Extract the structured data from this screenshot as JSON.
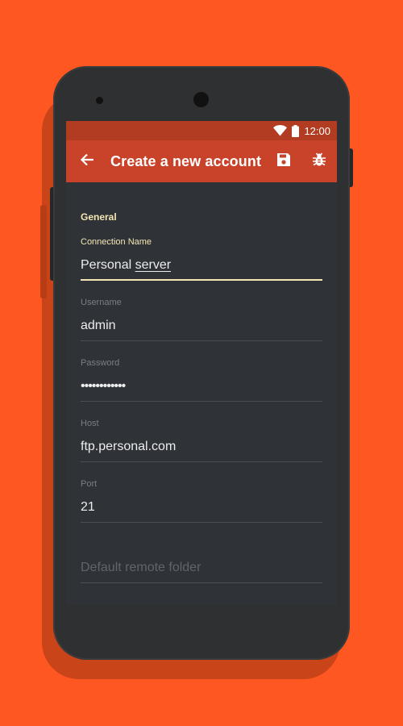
{
  "status_bar": {
    "time": "12:00"
  },
  "app_bar": {
    "title": "Create a new account"
  },
  "form": {
    "section_title": "General",
    "fields": [
      {
        "label": "Connection Name",
        "value_prefix": "Personal ",
        "value_underlined": "server"
      },
      {
        "label": "Username",
        "value": "admin"
      },
      {
        "label": "Password",
        "value": "••••••••••••"
      },
      {
        "label": "Host",
        "value": "ftp.personal.com"
      },
      {
        "label": "Port",
        "value": "21"
      },
      {
        "placeholder": "Default remote folder"
      }
    ]
  },
  "colors": {
    "background": "#fe5722",
    "app_bar": "#c9432a",
    "status_bar": "#b13c21",
    "screen_bg": "#2f3236",
    "accent": "#f4e6b4"
  },
  "icons": [
    "wifi-icon",
    "battery-icon",
    "back-arrow-icon",
    "save-icon",
    "bug-icon"
  ]
}
